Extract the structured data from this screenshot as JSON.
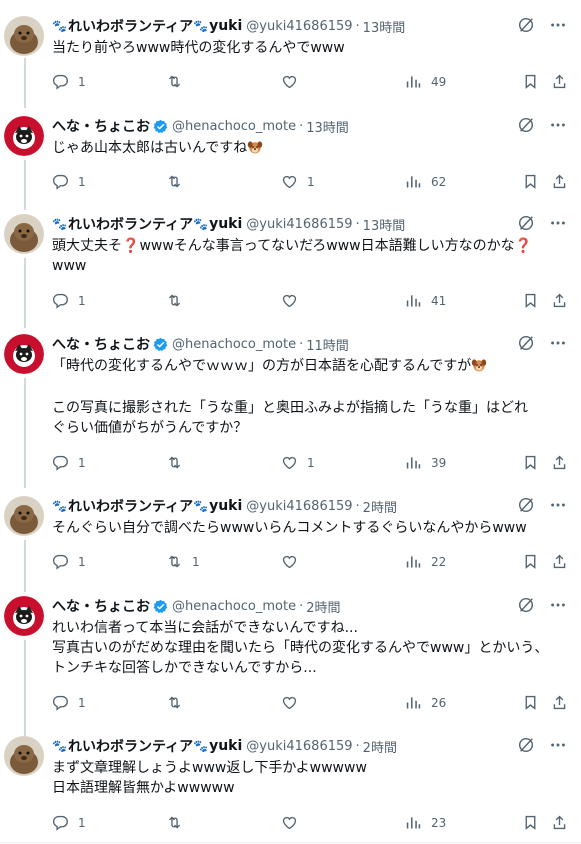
{
  "users": {
    "yuki": {
      "name": "れいわボランティア",
      "name_suffix": "yuki",
      "handle": "@yuki41686159",
      "paw": "🐾"
    },
    "hena": {
      "name": "へな・ちょこお",
      "handle": "@henachoco_mote"
    }
  },
  "separator": "·",
  "tweets": [
    {
      "time": "13時間",
      "text": "当たり前やろwww時代の変化するんやでwww",
      "reply_count": "1",
      "repost_count": "",
      "like_count": "",
      "views": "49"
    },
    {
      "time": "13時間",
      "text": "じゃあ山本太郎は古いんですね",
      "reply_count": "1",
      "repost_count": "",
      "like_count": "1",
      "views": "62"
    },
    {
      "time": "13時間",
      "text_a": "頭大丈夫そ",
      "text_b": "wwwそんな事言ってないだろwww日本語難しい方なのかな",
      "text_c": "www",
      "question_mark": "❓",
      "reply_count": "1",
      "repost_count": "",
      "like_count": "",
      "views": "41"
    },
    {
      "time": "11時間",
      "text_a": "「時代の変化するんやでｗｗｗ」の方が日本語を心配するんですが",
      "text_b": "この写真に撮影された「うな重」と奥田ふみよが指摘した「うな重」はどれ\nぐらい価値がちがうんですか？",
      "reply_count": "1",
      "repost_count": "",
      "like_count": "1",
      "views": "39"
    },
    {
      "time": "2時間",
      "text": "そんぐらい自分で調べたらwwwいらんコメントするぐらいなんやからwww",
      "reply_count": "1",
      "repost_count": "1",
      "like_count": "",
      "views": "22"
    },
    {
      "time": "2時間",
      "text": "れいわ信者って本当に会話ができないんですね...\n写真古いのがだめな理由を聞いたら「時代の変化するんやでwww」とかいう、\nトンチキな回答しかできないんですから...",
      "reply_count": "1",
      "repost_count": "",
      "like_count": "",
      "views": "26"
    },
    {
      "time": "2時間",
      "text": "まず文章理解しょうよwww返し下手かよwwwww\n日本語理解皆無かよwwwww",
      "reply_count": "1",
      "repost_count": "",
      "like_count": "",
      "views": "23"
    }
  ],
  "colors": {
    "text": "#0f1419",
    "secondary": "#536471",
    "verified": "#1d9bf0",
    "separator": "#eff3f4",
    "thread_line": "#cfd9de"
  }
}
